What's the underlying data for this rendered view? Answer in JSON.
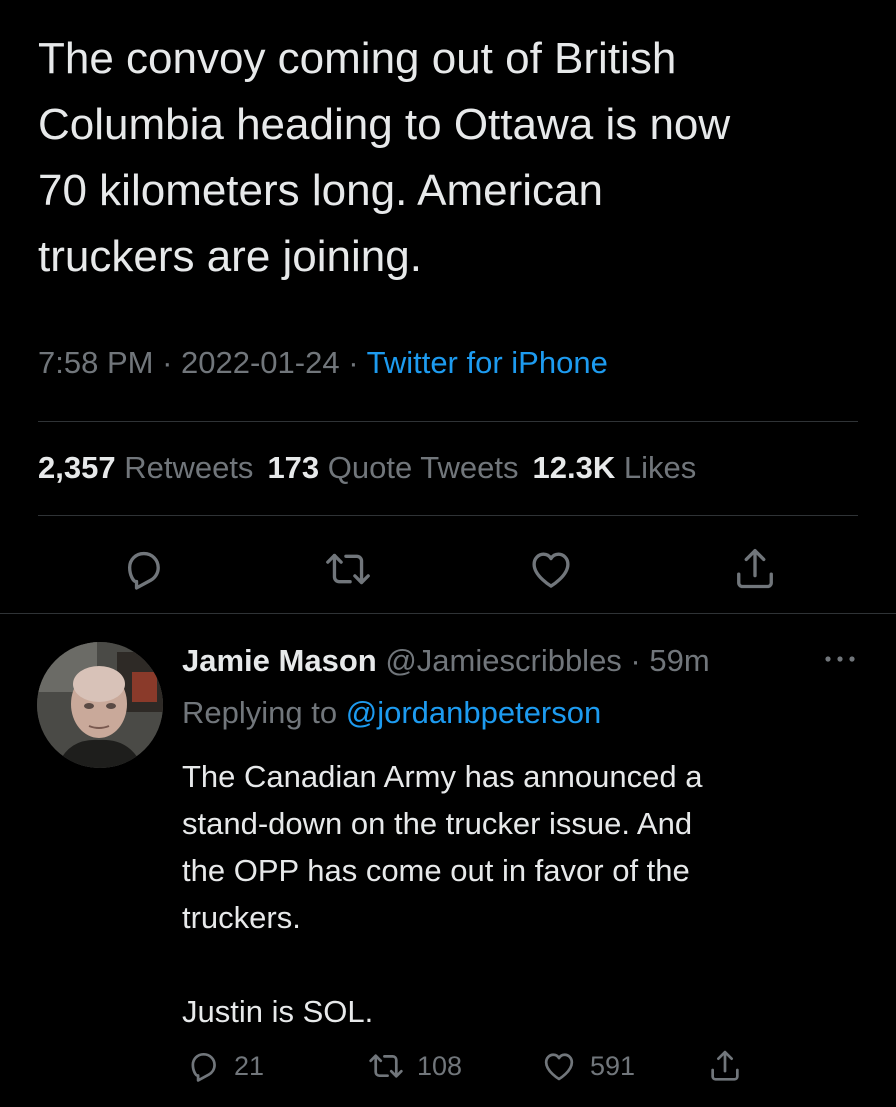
{
  "main_tweet": {
    "text": "The convoy coming out of British\nColumbia heading to Ottawa is now\n70 kilometers long. American\ntruckers are joining.",
    "time": "7:58 PM",
    "date": "2022-01-24",
    "source": "Twitter for iPhone",
    "separator": " · ",
    "stats": {
      "retweets_count": "2,357",
      "retweets_label": "Retweets",
      "quotes_count": "173",
      "quotes_label": "Quote Tweets",
      "likes_count": "12.3K",
      "likes_label": "Likes"
    },
    "actions": {
      "reply_icon": "reply-icon",
      "retweet_icon": "retweet-icon",
      "like_icon": "heart-icon",
      "share_icon": "share-icon"
    }
  },
  "reply": {
    "name": "Jamie Mason",
    "handle": "@Jamiescribbles",
    "age": "59m",
    "replying_label": "Replying to",
    "replying_to": "@jordanbpeterson",
    "text": "The Canadian Army has announced a\nstand-down on the trucker issue. And\nthe OPP has come out in favor of the\ntruckers.\n\nJustin is SOL.",
    "counts": {
      "replies": "21",
      "retweets": "108",
      "likes": "591"
    }
  },
  "colors": {
    "background": "#000000",
    "text": "#e7e9ea",
    "muted": "#71767b",
    "accent": "#1d9bf0",
    "divider": "#2f3336"
  }
}
